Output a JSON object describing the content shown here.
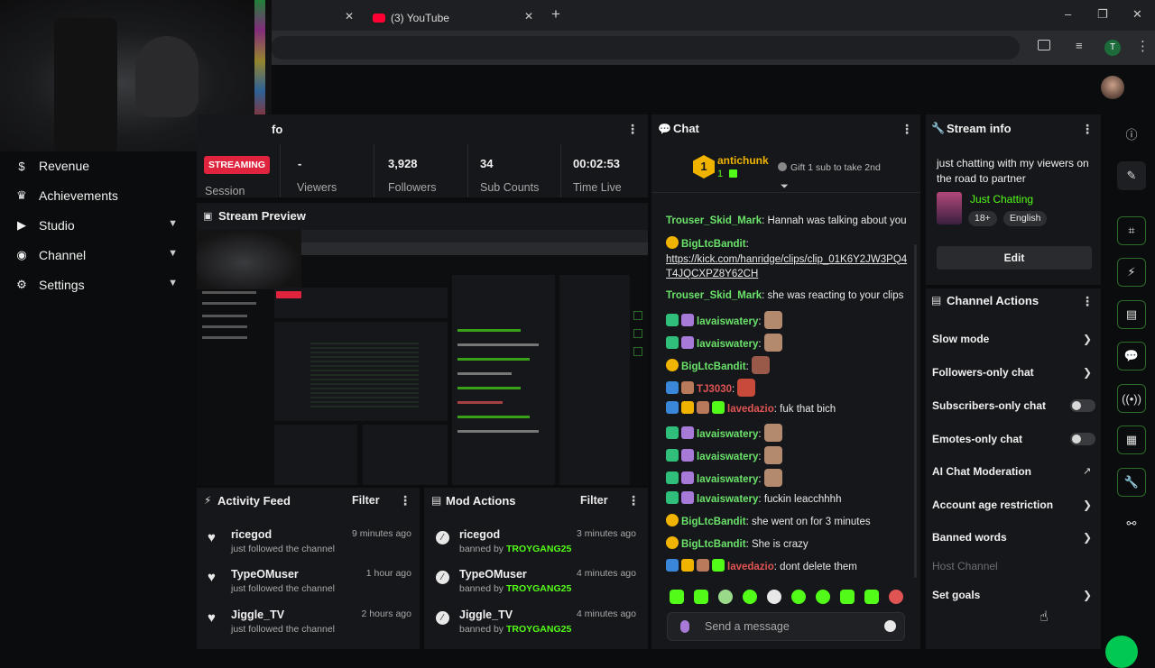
{
  "browser": {
    "tabs": [
      {
        "label": "(3) YouTube"
      }
    ],
    "window_controls": {
      "minimize": "–",
      "maximize": "❐",
      "close": "✕"
    },
    "profile_initial": "T"
  },
  "sidebar": {
    "items": [
      {
        "label": "Revenue",
        "icon": "dollar-icon",
        "glyph": "$"
      },
      {
        "label": "Achievements",
        "icon": "trophy-icon",
        "glyph": "🏆"
      },
      {
        "label": "Studio",
        "icon": "video-icon",
        "glyph": "▶"
      },
      {
        "label": "Channel",
        "icon": "broadcast-icon",
        "glyph": "◉"
      },
      {
        "label": "Settings",
        "icon": "gear-icon",
        "glyph": "⚙"
      }
    ]
  },
  "session": {
    "title_partial": "fo",
    "status": "STREAMING",
    "session_label": "Session",
    "stats": [
      {
        "value": "-",
        "label": "Viewers"
      },
      {
        "value": "3,928",
        "label": "Followers"
      },
      {
        "value": "34",
        "label": "Sub Counts"
      },
      {
        "value": "00:02:53",
        "label": "Time Live"
      }
    ]
  },
  "preview": {
    "title": "Stream Preview"
  },
  "activity_feed": {
    "title": "Activity Feed",
    "filter": "Filter",
    "items": [
      {
        "user": "ricegod",
        "action": "just followed the channel",
        "time": "9 minutes ago"
      },
      {
        "user": "TypeOMuser",
        "action": "just followed the channel",
        "time": "1 hour ago"
      },
      {
        "user": "Jiggle_TV",
        "action": "just followed the channel",
        "time": "2 hours ago"
      }
    ]
  },
  "mod_actions": {
    "title": "Mod Actions",
    "filter": "Filter",
    "items": [
      {
        "user": "ricegod",
        "action": "banned by",
        "by": "TROYGANG25",
        "time": "3 minutes ago"
      },
      {
        "user": "TypeOMuser",
        "action": "banned by",
        "by": "TROYGANG25",
        "time": "4 minutes ago"
      },
      {
        "user": "Jiggle_TV",
        "action": "banned by",
        "by": "TROYGANG25",
        "time": "4 minutes ago"
      }
    ]
  },
  "chat": {
    "title": "Chat",
    "pinned": {
      "rank": "1",
      "user": "antichunk",
      "count": "1",
      "gift_text": "Gift 1 sub to take 2nd"
    },
    "messages": [
      {
        "user": "Trouser_Skid_Mark",
        "color": "#6be36b",
        "text": "Hannah was talking about you"
      },
      {
        "user": "BigLtcBandit",
        "color": "#6be36b",
        "text": "https://kick.com/hanridge/clips/clip_01K6Y2JW3PQ4T4JQCXPZ8Y62CH"
      },
      {
        "user": "Trouser_Skid_Mark",
        "color": "#6be36b",
        "text": "she was reacting to your clips"
      },
      {
        "user": "lavaiswatery",
        "color": "#6be36b",
        "text": ""
      },
      {
        "user": "lavaiswatery",
        "color": "#6be36b",
        "text": ""
      },
      {
        "user": "BigLtcBandit",
        "color": "#6be36b",
        "text": ""
      },
      {
        "user": "TJ3030",
        "color": "#e05454",
        "text": ""
      },
      {
        "user": "lavedazio",
        "color": "#e05454",
        "text": "fuk that bich"
      },
      {
        "user": "lavaiswatery",
        "color": "#6be36b",
        "text": ""
      },
      {
        "user": "lavaiswatery",
        "color": "#6be36b",
        "text": ""
      },
      {
        "user": "lavaiswatery",
        "color": "#6be36b",
        "text": ""
      },
      {
        "user": "lavaiswatery",
        "color": "#6be36b",
        "text": "fuckin leacchhhh"
      },
      {
        "user": "BigLtcBandit",
        "color": "#6be36b",
        "text": "she went on for 3 minutes"
      },
      {
        "user": "BigLtcBandit",
        "color": "#6be36b",
        "text": "She is crazy"
      },
      {
        "user": "lavedazio",
        "color": "#e05454",
        "text": "dont delete them"
      }
    ],
    "input_placeholder": "Send a message"
  },
  "stream_info": {
    "title": "Stream info",
    "stream_title": "just chatting with my viewers on the road to partner",
    "category": "Just Chatting",
    "tags": [
      "18+",
      "English"
    ],
    "edit_label": "Edit"
  },
  "channel_actions": {
    "title": "Channel Actions",
    "items": [
      {
        "label": "Slow mode",
        "control": "arrow"
      },
      {
        "label": "Followers-only chat",
        "control": "arrow"
      },
      {
        "label": "Subscribers-only chat",
        "control": "toggle",
        "on": false
      },
      {
        "label": "Emotes-only chat",
        "control": "toggle",
        "on": false
      },
      {
        "label": "AI Chat Moderation",
        "control": "external"
      },
      {
        "label": "Account age restriction",
        "control": "arrow"
      },
      {
        "label": "Banned words",
        "control": "arrow"
      },
      {
        "label": "Host Channel",
        "control": "none",
        "disabled": true
      },
      {
        "label": "Set goals",
        "control": "arrow"
      }
    ]
  },
  "colors": {
    "accent": "#53fc18",
    "streaming": "#e0243d",
    "panel": "#16171a",
    "background": "#0b0c0d"
  }
}
